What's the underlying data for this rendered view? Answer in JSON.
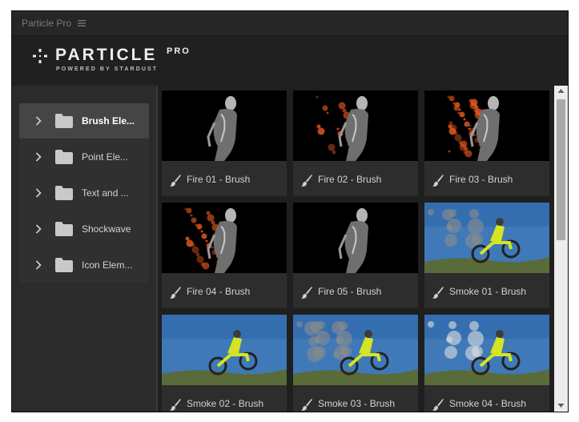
{
  "window": {
    "title": "Particle Pro"
  },
  "header": {
    "brand": "PARTICLE",
    "brand_sup": "PRO",
    "tagline": "POWERED BY STARDUST"
  },
  "sidebar": {
    "items": [
      {
        "label": "Brush Ele...",
        "active": true
      },
      {
        "label": "Point Ele...",
        "active": false
      },
      {
        "label": "Text and ...",
        "active": false
      },
      {
        "label": "Shockwave",
        "active": false
      },
      {
        "label": "Icon Elem...",
        "active": false
      }
    ]
  },
  "presets": [
    {
      "label": "Fire 01 - Brush",
      "thumb": "fire"
    },
    {
      "label": "Fire 02 - Brush",
      "thumb": "fire"
    },
    {
      "label": "Fire 03 - Brush",
      "thumb": "fire"
    },
    {
      "label": "Fire 04 - Brush",
      "thumb": "fire"
    },
    {
      "label": "Fire 05 - Brush",
      "thumb": "fire"
    },
    {
      "label": "Smoke 01 - Brush",
      "thumb": "smoke"
    },
    {
      "label": "Smoke 02 - Brush",
      "thumb": "smoke"
    },
    {
      "label": "Smoke 03 - Brush",
      "thumb": "smoke"
    },
    {
      "label": "Smoke 04 - Brush",
      "thumb": "smoke"
    }
  ],
  "colors": {
    "accent": "#e85a1e",
    "sky": "#3f79b8",
    "rider": "#d7e421"
  },
  "icons": {
    "folder": "folder-icon",
    "expand": "chevron-right-icon",
    "preset": "brush-icon",
    "menu": "hamburger-icon"
  }
}
